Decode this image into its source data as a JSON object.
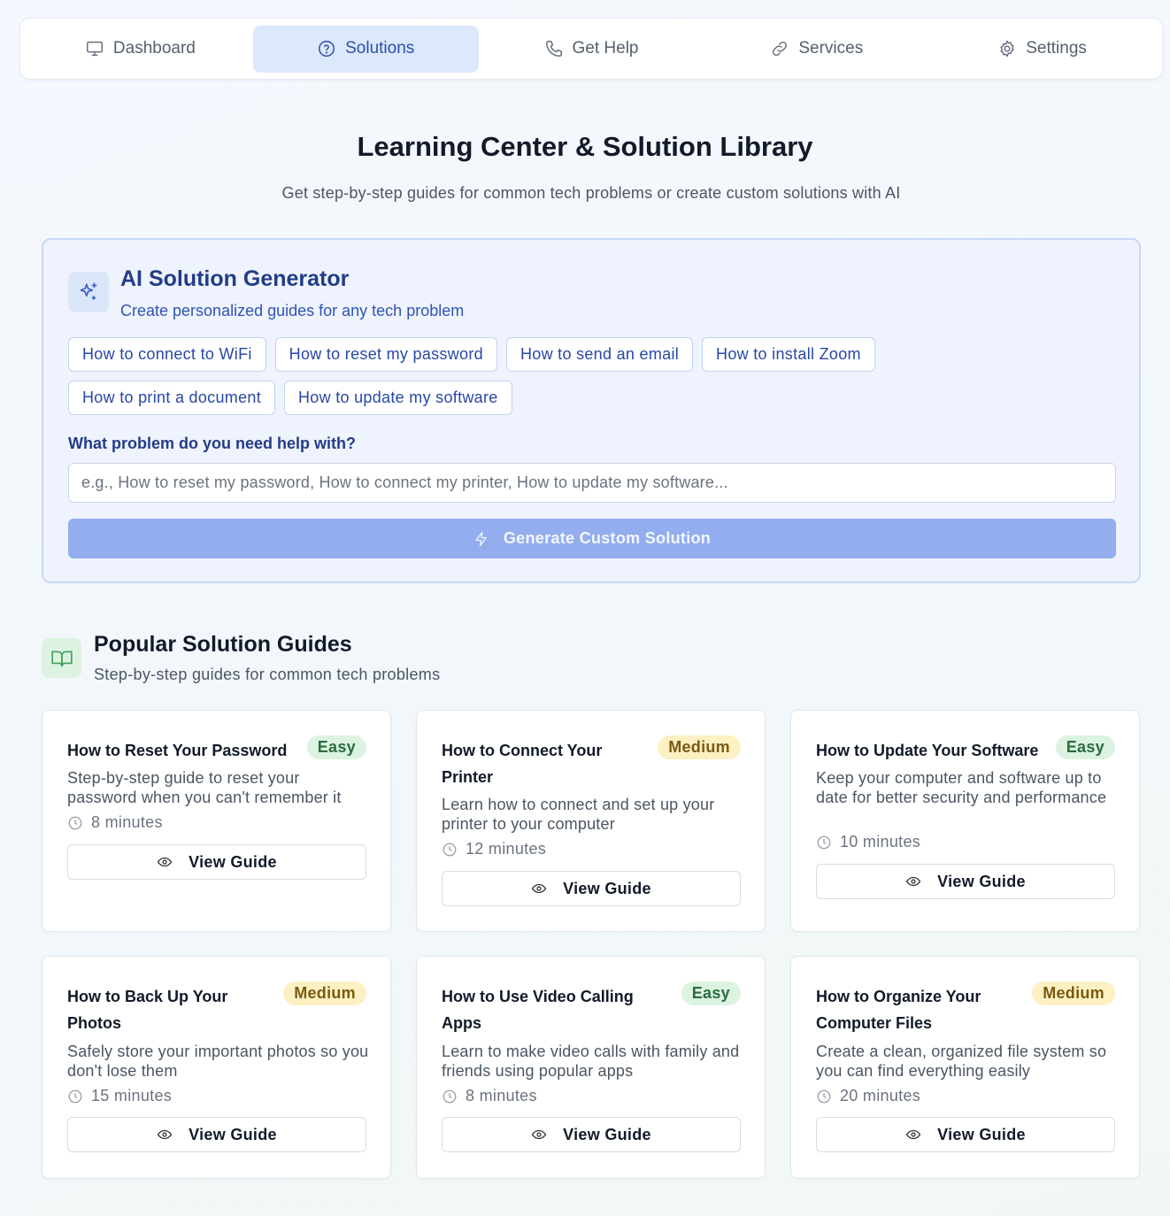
{
  "nav": {
    "items": [
      {
        "label": "Dashboard",
        "icon": "monitor-icon",
        "active": false
      },
      {
        "label": "Solutions",
        "icon": "help-circle-icon",
        "active": true
      },
      {
        "label": "Get Help",
        "icon": "phone-icon",
        "active": false
      },
      {
        "label": "Services",
        "icon": "link-icon",
        "active": false
      },
      {
        "label": "Settings",
        "icon": "gear-icon",
        "active": false
      }
    ]
  },
  "hero": {
    "title": "Learning Center & Solution Library",
    "subtitle": "Get step-by-step guides for common tech problems or create custom solutions with AI"
  },
  "ai": {
    "title": "AI Solution Generator",
    "subtitle": "Create personalized guides for any tech problem",
    "chips": [
      "How to connect to WiFi",
      "How to reset my password",
      "How to send an email",
      "How to install Zoom",
      "How to print a document",
      "How to update my software"
    ],
    "question_label": "What problem do you need help with?",
    "input_value": "",
    "input_placeholder": "e.g., How to reset my password, How to connect my printer, How to update my software...",
    "generate_label": "Generate Custom Solution"
  },
  "popular": {
    "title": "Popular Solution Guides",
    "subtitle": "Step-by-step guides for common tech problems",
    "view_label": "View Guide",
    "guides": [
      {
        "title": "How to Reset Your Password",
        "difficulty": "Easy",
        "description": "Step-by-step guide to reset your password when you can't remember it",
        "time": "8 minutes"
      },
      {
        "title": "How to Connect Your Printer",
        "difficulty": "Medium",
        "description": "Learn how to connect and set up your printer to your computer",
        "time": "12 minutes"
      },
      {
        "title": "How to Update Your Software",
        "difficulty": "Easy",
        "description": "Keep your computer and software up to date for better security and performance",
        "time": "10 minutes"
      },
      {
        "title": "How to Back Up Your Photos",
        "difficulty": "Medium",
        "description": "Safely store your important photos so you don't lose them",
        "time": "15 minutes"
      },
      {
        "title": "How to Use Video Calling Apps",
        "difficulty": "Easy",
        "description": "Learn to make video calls with family and friends using popular apps",
        "time": "8 minutes"
      },
      {
        "title": "How to Organize Your Computer Files",
        "difficulty": "Medium",
        "description": "Create a clean, organized file system so you can find everything easily",
        "time": "20 minutes"
      }
    ]
  },
  "colors": {
    "accent": "#2a4fb0",
    "nav_active_bg": "#dce8fb",
    "ai_panel_bg": "#eff3fd",
    "generate_button": "#93adef",
    "easy_badge": "#dcf3e2",
    "medium_badge": "#fdf1c3"
  }
}
